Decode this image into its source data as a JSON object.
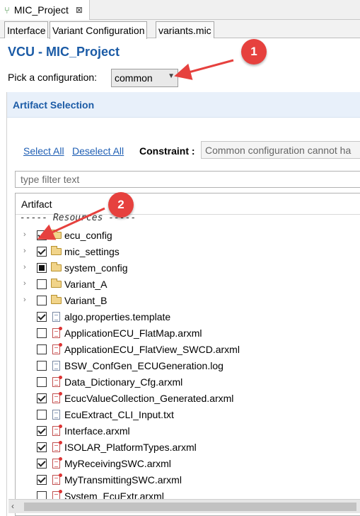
{
  "editor_tab": {
    "title": "MIC_Project",
    "close_glyph": "⊠"
  },
  "page_tabs": [
    "Interface",
    "Variant Configuration",
    "variants.mic"
  ],
  "header": {
    "title": "VCU - MIC_Project",
    "config_label": "Pick a configuration:",
    "config_value": "common"
  },
  "section": {
    "title": "Artifact Selection",
    "select_all": "Select All",
    "deselect_all": "Deselect All",
    "constraint_label": "Constraint :",
    "constraint_value": "Common configuration cannot ha",
    "filter_placeholder": "type filter text"
  },
  "tree": {
    "column_header": "Artifact",
    "group_label": "----- Resources -----",
    "rows": [
      {
        "name": "ecu_config",
        "icon": "folder-icon",
        "check": "checked",
        "expandable": true
      },
      {
        "name": "mic_settings",
        "icon": "folder-icon",
        "check": "checked",
        "expandable": true
      },
      {
        "name": "system_config",
        "icon": "folder-icon",
        "check": "partial",
        "expandable": true
      },
      {
        "name": "Variant_A",
        "icon": "folder-icon",
        "check": "unchecked",
        "expandable": true
      },
      {
        "name": "Variant_B",
        "icon": "folder-icon",
        "check": "unchecked",
        "expandable": true
      },
      {
        "name": "algo.properties.template",
        "icon": "document-icon",
        "check": "checked",
        "expandable": false
      },
      {
        "name": "ApplicationECU_FlatMap.arxml",
        "icon": "arxml-icon",
        "check": "unchecked",
        "expandable": false
      },
      {
        "name": "ApplicationECU_FlatView_SWCD.arxml",
        "icon": "arxml-icon",
        "check": "unchecked",
        "expandable": false
      },
      {
        "name": "BSW_ConfGen_ECUGeneration.log",
        "icon": "document-icon",
        "check": "unchecked",
        "expandable": false
      },
      {
        "name": "Data_Dictionary_Cfg.arxml",
        "icon": "arxml-icon",
        "check": "unchecked",
        "expandable": false
      },
      {
        "name": "EcucValueCollection_Generated.arxml",
        "icon": "arxml-icon",
        "check": "checked",
        "expandable": false
      },
      {
        "name": "EcuExtract_CLI_Input.txt",
        "icon": "document-icon",
        "check": "unchecked",
        "expandable": false
      },
      {
        "name": "Interface.arxml",
        "icon": "arxml-icon",
        "check": "checked",
        "expandable": false
      },
      {
        "name": "ISOLAR_PlatformTypes.arxml",
        "icon": "arxml-icon",
        "check": "checked",
        "expandable": false
      },
      {
        "name": "MyReceivingSWC.arxml",
        "icon": "arxml-icon",
        "check": "checked",
        "expandable": false
      },
      {
        "name": "MyTransmittingSWC.arxml",
        "icon": "arxml-icon",
        "check": "checked",
        "expandable": false
      },
      {
        "name": "System_EcuExtr.arxml",
        "icon": "arxml-icon",
        "check": "unchecked",
        "expandable": false
      }
    ]
  },
  "annotations": {
    "callout_1": "1",
    "callout_2": "2",
    "accent_color": "#e6413e"
  }
}
